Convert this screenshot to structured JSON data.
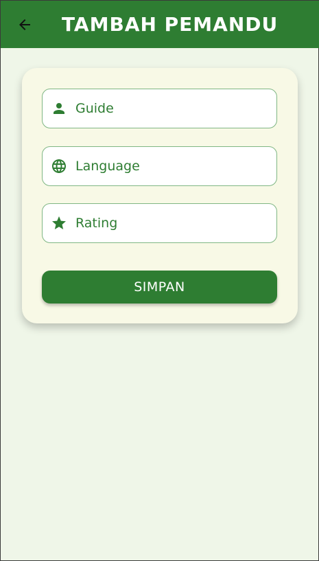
{
  "appbar": {
    "title": "TAMBAH PEMANDU",
    "back_icon": "arrow-back-icon",
    "background_color": "#2e7d32"
  },
  "form": {
    "fields": [
      {
        "icon": "person-icon",
        "placeholder": "Guide"
      },
      {
        "icon": "globe-icon",
        "placeholder": "Language"
      },
      {
        "icon": "star-icon",
        "placeholder": "Rating"
      }
    ],
    "submit_label": "SIMPAN"
  },
  "colors": {
    "accent": "#2e7d32",
    "background": "#eff6e8",
    "card": "#f8f9e6",
    "field_border": "#7fb683"
  }
}
